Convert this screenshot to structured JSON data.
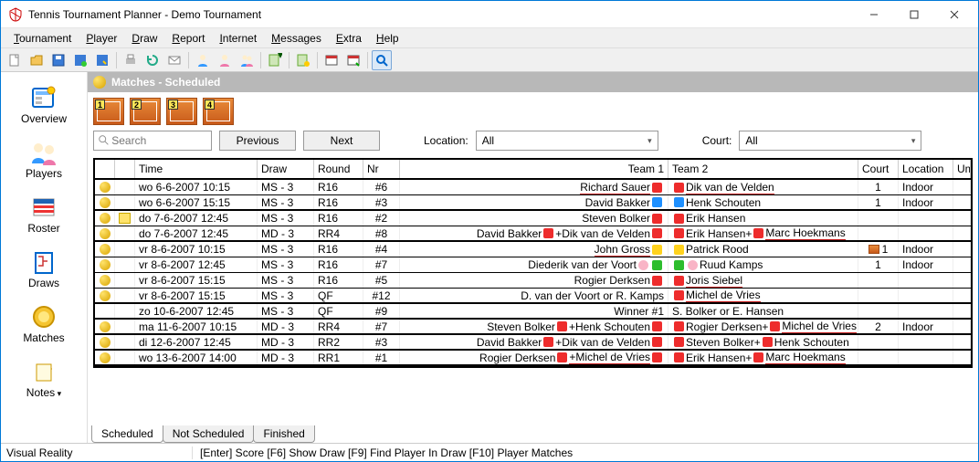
{
  "window": {
    "title": "Tennis Tournament Planner - Demo Tournament"
  },
  "menu": [
    "Tournament",
    "Player",
    "Draw",
    "Report",
    "Internet",
    "Messages",
    "Extra",
    "Help"
  ],
  "sidebar": [
    {
      "name": "overview",
      "label": "Overview"
    },
    {
      "name": "players",
      "label": "Players"
    },
    {
      "name": "roster",
      "label": "Roster"
    },
    {
      "name": "draws",
      "label": "Draws"
    },
    {
      "name": "matches",
      "label": "Matches"
    },
    {
      "name": "notes",
      "label": "Notes",
      "dropdown": true
    }
  ],
  "section_title": "Matches - Scheduled",
  "court_buttons": [
    "1",
    "2",
    "3",
    "4"
  ],
  "search": {
    "placeholder": "Search"
  },
  "nav": {
    "previous": "Previous",
    "next": "Next"
  },
  "filters": {
    "location_label": "Location:",
    "location_value": "All",
    "court_label": "Court:",
    "court_value": "All"
  },
  "columns": [
    "",
    "",
    "Time",
    "Draw",
    "Round",
    "Nr",
    "Team 1",
    "Team 2",
    "Court",
    "Location",
    "Umpire"
  ],
  "rows": [
    {
      "thick": false,
      "note": false,
      "time": "wo 6-6-2007 10:15",
      "draw": "MS - 3",
      "round": "R16",
      "nr": "#6",
      "t1": [
        {
          "txt": "Richard Sauer",
          "ul": true
        },
        {
          "sq": "red"
        }
      ],
      "t2": [
        {
          "sq": "red"
        },
        {
          "txt": "Dik van de Velden",
          "ul": true
        }
      ],
      "court": "1",
      "loc": "Indoor"
    },
    {
      "thick": true,
      "note": false,
      "time": "wo 6-6-2007 15:15",
      "draw": "MS - 3",
      "round": "R16",
      "nr": "#3",
      "t1": [
        {
          "txt": "David Bakker"
        },
        {
          "sq": "blue"
        }
      ],
      "t2": [
        {
          "sq": "blue"
        },
        {
          "txt": "Henk Schouten"
        }
      ],
      "court": "1",
      "loc": "Indoor"
    },
    {
      "thick": false,
      "note": true,
      "time": "do 7-6-2007 12:45",
      "draw": "MS - 3",
      "round": "R16",
      "nr": "#2",
      "t1": [
        {
          "txt": "Steven Bolker"
        },
        {
          "sq": "red"
        }
      ],
      "t2": [
        {
          "sq": "red"
        },
        {
          "txt": "Erik Hansen"
        }
      ],
      "court": "",
      "loc": ""
    },
    {
      "thick": true,
      "note": false,
      "time": "do 7-6-2007 12:45",
      "draw": "MD - 3",
      "round": "RR4",
      "nr": "#8",
      "t1": [
        {
          "txt": "David Bakker"
        },
        {
          "sq": "red"
        },
        {
          "txt": "+Dik van de Velden"
        },
        {
          "sq": "red"
        }
      ],
      "t2": [
        {
          "sq": "red"
        },
        {
          "txt": "Erik Hansen+"
        },
        {
          "sq": "red"
        },
        {
          "txt": "Marc Hoekmans",
          "ul": true
        }
      ],
      "court": "",
      "loc": ""
    },
    {
      "thick": false,
      "note": false,
      "time": "vr 8-6-2007 10:15",
      "draw": "MS - 3",
      "round": "R16",
      "nr": "#4",
      "t1": [
        {
          "txt": "John Gross",
          "ul": true
        },
        {
          "sq": "yellow"
        }
      ],
      "t2": [
        {
          "sq": "yellow"
        },
        {
          "txt": "Patrick Rood"
        }
      ],
      "court": "1",
      "loc": "Indoor",
      "courtIcon": true
    },
    {
      "thick": false,
      "note": false,
      "time": "vr 8-6-2007 12:45",
      "draw": "MS - 3",
      "round": "R16",
      "nr": "#7",
      "t1": [
        {
          "txt": "Diederik van der Voort"
        },
        {
          "sq": "pink"
        },
        {
          "sq": "green"
        }
      ],
      "t2": [
        {
          "sq": "green"
        },
        {
          "sq": "pink"
        },
        {
          "txt": "Ruud Kamps"
        }
      ],
      "court": "1",
      "loc": "Indoor"
    },
    {
      "thick": false,
      "note": false,
      "time": "vr 8-6-2007 15:15",
      "draw": "MS - 3",
      "round": "R16",
      "nr": "#5",
      "t1": [
        {
          "txt": "Rogier Derksen"
        },
        {
          "sq": "red"
        }
      ],
      "t2": [
        {
          "sq": "red"
        },
        {
          "txt": "Joris Siebel",
          "ul": true
        }
      ],
      "court": "",
      "loc": ""
    },
    {
      "thick": true,
      "note": false,
      "time": "vr 8-6-2007 15:15",
      "draw": "MS - 3",
      "round": "QF",
      "nr": "#12",
      "t1": [
        {
          "txt": "D. van der Voort or R. Kamps"
        }
      ],
      "t2": [
        {
          "sq": "red"
        },
        {
          "txt": "Michel de Vries",
          "ul": true
        }
      ],
      "court": "",
      "loc": ""
    },
    {
      "thick": true,
      "note": false,
      "coin": false,
      "time": "zo 10-6-2007 12:45",
      "draw": "MS - 3",
      "round": "QF",
      "nr": "#9",
      "t1": [
        {
          "txt": "Winner #1"
        }
      ],
      "t2": [
        {
          "txt": "S. Bolker or E. Hansen"
        }
      ],
      "court": "",
      "loc": ""
    },
    {
      "thick": true,
      "note": false,
      "time": "ma 11-6-2007 10:15",
      "draw": "MD - 3",
      "round": "RR4",
      "nr": "#7",
      "t1": [
        {
          "txt": "Steven Bolker"
        },
        {
          "sq": "red"
        },
        {
          "txt": "+Henk Schouten"
        },
        {
          "sq": "red"
        }
      ],
      "t2": [
        {
          "sq": "red"
        },
        {
          "txt": "Rogier Derksen+"
        },
        {
          "sq": "red"
        },
        {
          "txt": "Michel de Vries",
          "ul": true
        }
      ],
      "court": "2",
      "loc": "Indoor"
    },
    {
      "thick": true,
      "note": false,
      "time": "di 12-6-2007 12:45",
      "draw": "MD - 3",
      "round": "RR2",
      "nr": "#3",
      "t1": [
        {
          "txt": "David Bakker"
        },
        {
          "sq": "red"
        },
        {
          "txt": "+Dik van de Velden"
        },
        {
          "sq": "red"
        }
      ],
      "t2": [
        {
          "sq": "red"
        },
        {
          "txt": "Steven Bolker+"
        },
        {
          "sq": "red"
        },
        {
          "txt": "Henk Schouten"
        }
      ],
      "court": "",
      "loc": ""
    },
    {
      "thick": true,
      "note": false,
      "time": "wo 13-6-2007 14:00",
      "draw": "MD - 3",
      "round": "RR1",
      "nr": "#1",
      "t1": [
        {
          "txt": "Rogier Derksen"
        },
        {
          "sq": "red"
        },
        {
          "txt": "+Michel de Vries",
          "ul": true
        },
        {
          "sq": "red"
        }
      ],
      "t2": [
        {
          "sq": "red"
        },
        {
          "txt": "Erik Hansen+"
        },
        {
          "sq": "red"
        },
        {
          "txt": "Marc Hoekmans",
          "ul": true
        }
      ],
      "court": "",
      "loc": ""
    }
  ],
  "tabs": [
    {
      "label": "Scheduled",
      "active": true
    },
    {
      "label": "Not Scheduled",
      "active": false
    },
    {
      "label": "Finished",
      "active": false
    }
  ],
  "status": {
    "brand": "Visual Reality",
    "hint": "[Enter] Score [F6] Show Draw [F9] Find Player In Draw  [F10] Player Matches"
  }
}
